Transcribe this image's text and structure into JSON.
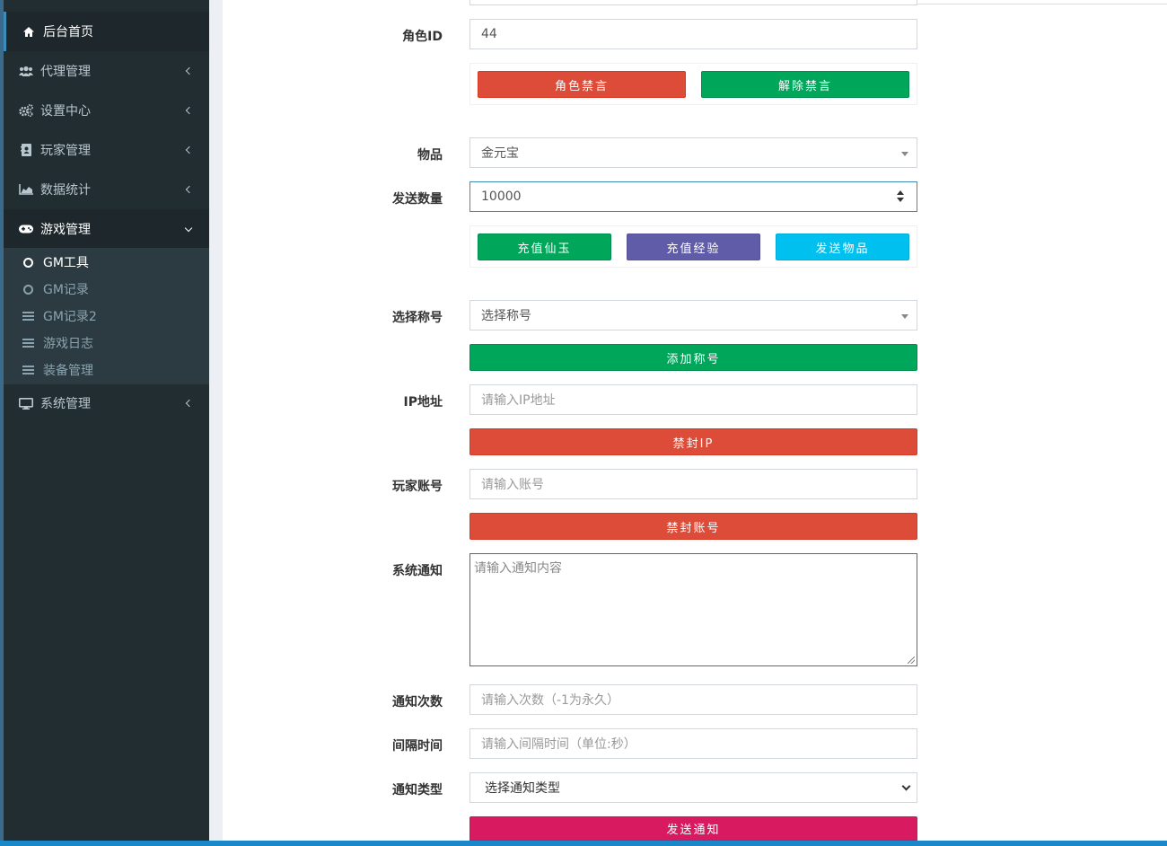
{
  "sidebar": {
    "items": [
      {
        "label": "后台首页",
        "icon": "home-icon"
      },
      {
        "label": "代理管理",
        "icon": "users-icon"
      },
      {
        "label": "设置中心",
        "icon": "cogs-icon"
      },
      {
        "label": "玩家管理",
        "icon": "address-book-icon"
      },
      {
        "label": "数据统计",
        "icon": "area-chart-icon"
      },
      {
        "label": "游戏管理",
        "icon": "gamepad-icon"
      },
      {
        "label": "系统管理",
        "icon": "desktop-icon"
      }
    ],
    "submenu": [
      {
        "label": "GM工具",
        "icon": "circle-o-icon"
      },
      {
        "label": "GM记录",
        "icon": "circle-o-icon"
      },
      {
        "label": "GM记录2",
        "icon": "list-icon"
      },
      {
        "label": "游戏日志",
        "icon": "list-icon"
      },
      {
        "label": "装备管理",
        "icon": "list-icon"
      }
    ]
  },
  "form": {
    "role_id": {
      "label": "角色ID",
      "value": "44"
    },
    "mute_button": "角色禁言",
    "unmute_button": "解除禁言",
    "item": {
      "label": "物品",
      "value": "金元宝"
    },
    "quantity": {
      "label": "发送数量",
      "value": "10000"
    },
    "recharge_jade_button": "充值仙玉",
    "recharge_exp_button": "充值经验",
    "send_item_button": "发送物品",
    "title_select": {
      "label": "选择称号",
      "value": "选择称号"
    },
    "add_title_button": "添加称号",
    "ip": {
      "label": "IP地址",
      "placeholder": "请输入IP地址"
    },
    "ban_ip_button": "禁封IP",
    "account": {
      "label": "玩家账号",
      "placeholder": "请输入账号"
    },
    "ban_account_button": "禁封账号",
    "notice": {
      "label": "系统通知",
      "placeholder": "请输入通知内容"
    },
    "notice_count": {
      "label": "通知次数",
      "placeholder": "请输入次数（-1为永久）"
    },
    "interval": {
      "label": "间隔时间",
      "placeholder": "请输入间隔时间（单位:秒）"
    },
    "notice_type": {
      "label": "通知类型",
      "value": "选择通知类型"
    },
    "send_notice_button": "发送通知"
  },
  "colors": {
    "sidebar_bg": "#222d32",
    "red": "#dd4b39",
    "green": "#00a65a",
    "purple": "#605ca8",
    "aqua": "#00c0ef",
    "pink": "#d81b60",
    "accent": "#3c8dbc"
  }
}
